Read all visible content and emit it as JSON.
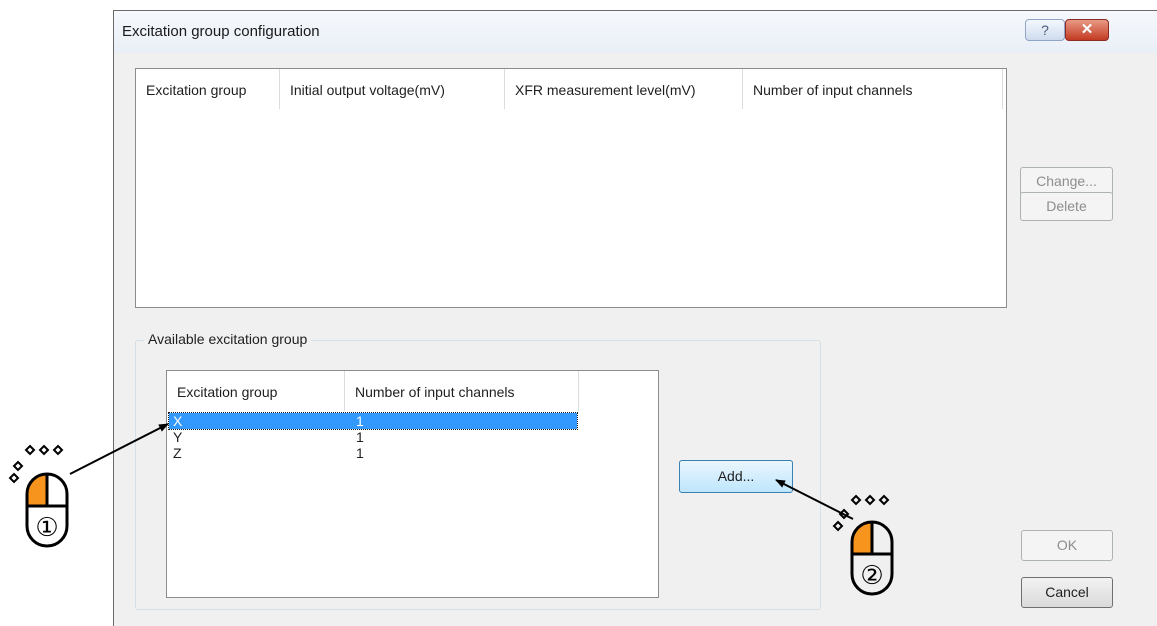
{
  "dialog": {
    "title": "Excitation group configuration",
    "help_glyph": "?",
    "close_glyph": "✕"
  },
  "configured_list": {
    "columns": [
      "Excitation group",
      "Initial output voltage(mV)",
      "XFR measurement level(mV)",
      "Number of input channels"
    ],
    "rows": []
  },
  "side_buttons": {
    "change_label": "Change...",
    "delete_label": "Delete"
  },
  "available": {
    "group_label": "Available excitation group",
    "columns": [
      "Excitation group",
      "Number of input channels"
    ],
    "rows": [
      {
        "group": "X",
        "channels": "1",
        "selected": true
      },
      {
        "group": "Y",
        "channels": "1",
        "selected": false
      },
      {
        "group": "Z",
        "channels": "1",
        "selected": false
      }
    ],
    "add_label": "Add..."
  },
  "footer": {
    "ok_label": "OK",
    "cancel_label": "Cancel"
  },
  "annotations": {
    "step1_label": "①",
    "step2_label": "②",
    "accent_color": "#f7941d"
  }
}
